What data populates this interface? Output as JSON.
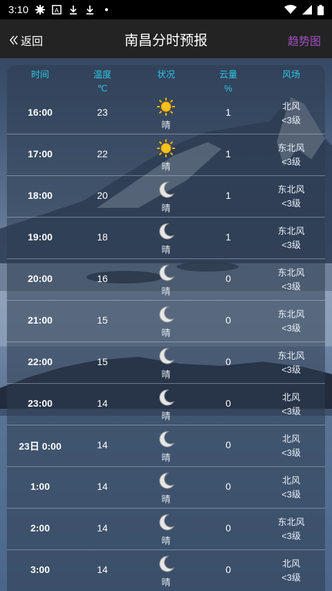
{
  "status_bar": {
    "time": "3:10",
    "icons": [
      "gear-icon",
      "a-box-icon",
      "download-icon",
      "download-icon",
      "dot-icon"
    ],
    "right_icons": [
      "wifi-icon",
      "signal-icon",
      "battery-icon"
    ]
  },
  "header": {
    "back_label": "返回",
    "title": "南昌分时预报",
    "trend_label": "趋势图"
  },
  "columns": {
    "time": "时间",
    "temp": "温度",
    "temp_unit": "℃",
    "condition": "状况",
    "cloud": "云量",
    "cloud_unit": "%",
    "wind": "风场"
  },
  "rows": [
    {
      "time": "16:00",
      "temp": "23",
      "icon": "sun-icon",
      "cond": "晴",
      "cloud": "1",
      "wind_dir": "北风",
      "wind_level": "<3级"
    },
    {
      "time": "17:00",
      "temp": "22",
      "icon": "sun-icon",
      "cond": "晴",
      "cloud": "1",
      "wind_dir": "东北风",
      "wind_level": "<3级"
    },
    {
      "time": "18:00",
      "temp": "20",
      "icon": "moon-icon",
      "cond": "晴",
      "cloud": "1",
      "wind_dir": "东北风",
      "wind_level": "<3级"
    },
    {
      "time": "19:00",
      "temp": "18",
      "icon": "moon-icon",
      "cond": "晴",
      "cloud": "1",
      "wind_dir": "东北风",
      "wind_level": "<3级"
    },
    {
      "time": "20:00",
      "temp": "16",
      "icon": "moon-icon",
      "cond": "晴",
      "cloud": "0",
      "wind_dir": "东北风",
      "wind_level": "<3级"
    },
    {
      "time": "21:00",
      "temp": "15",
      "icon": "moon-icon",
      "cond": "晴",
      "cloud": "0",
      "wind_dir": "东北风",
      "wind_level": "<3级"
    },
    {
      "time": "22:00",
      "temp": "15",
      "icon": "moon-icon",
      "cond": "晴",
      "cloud": "0",
      "wind_dir": "东北风",
      "wind_level": "<3级"
    },
    {
      "time": "23:00",
      "temp": "14",
      "icon": "moon-icon",
      "cond": "晴",
      "cloud": "0",
      "wind_dir": "北风",
      "wind_level": "<3级"
    },
    {
      "time": "23日 0:00",
      "temp": "14",
      "icon": "moon-icon",
      "cond": "晴",
      "cloud": "0",
      "wind_dir": "北风",
      "wind_level": "<3级"
    },
    {
      "time": "1:00",
      "temp": "14",
      "icon": "moon-icon",
      "cond": "晴",
      "cloud": "0",
      "wind_dir": "北风",
      "wind_level": "<3级"
    },
    {
      "time": "2:00",
      "temp": "14",
      "icon": "moon-icon",
      "cond": "晴",
      "cloud": "0",
      "wind_dir": "东北风",
      "wind_level": "<3级"
    },
    {
      "time": "3:00",
      "temp": "14",
      "icon": "moon-icon",
      "cond": "晴",
      "cloud": "0",
      "wind_dir": "北风",
      "wind_level": "<3级"
    }
  ],
  "colors": {
    "column_header": "#2ec5e6",
    "trend_link": "#a04fc0",
    "sun": "#f5b400",
    "moon": "#e6e6e6"
  }
}
